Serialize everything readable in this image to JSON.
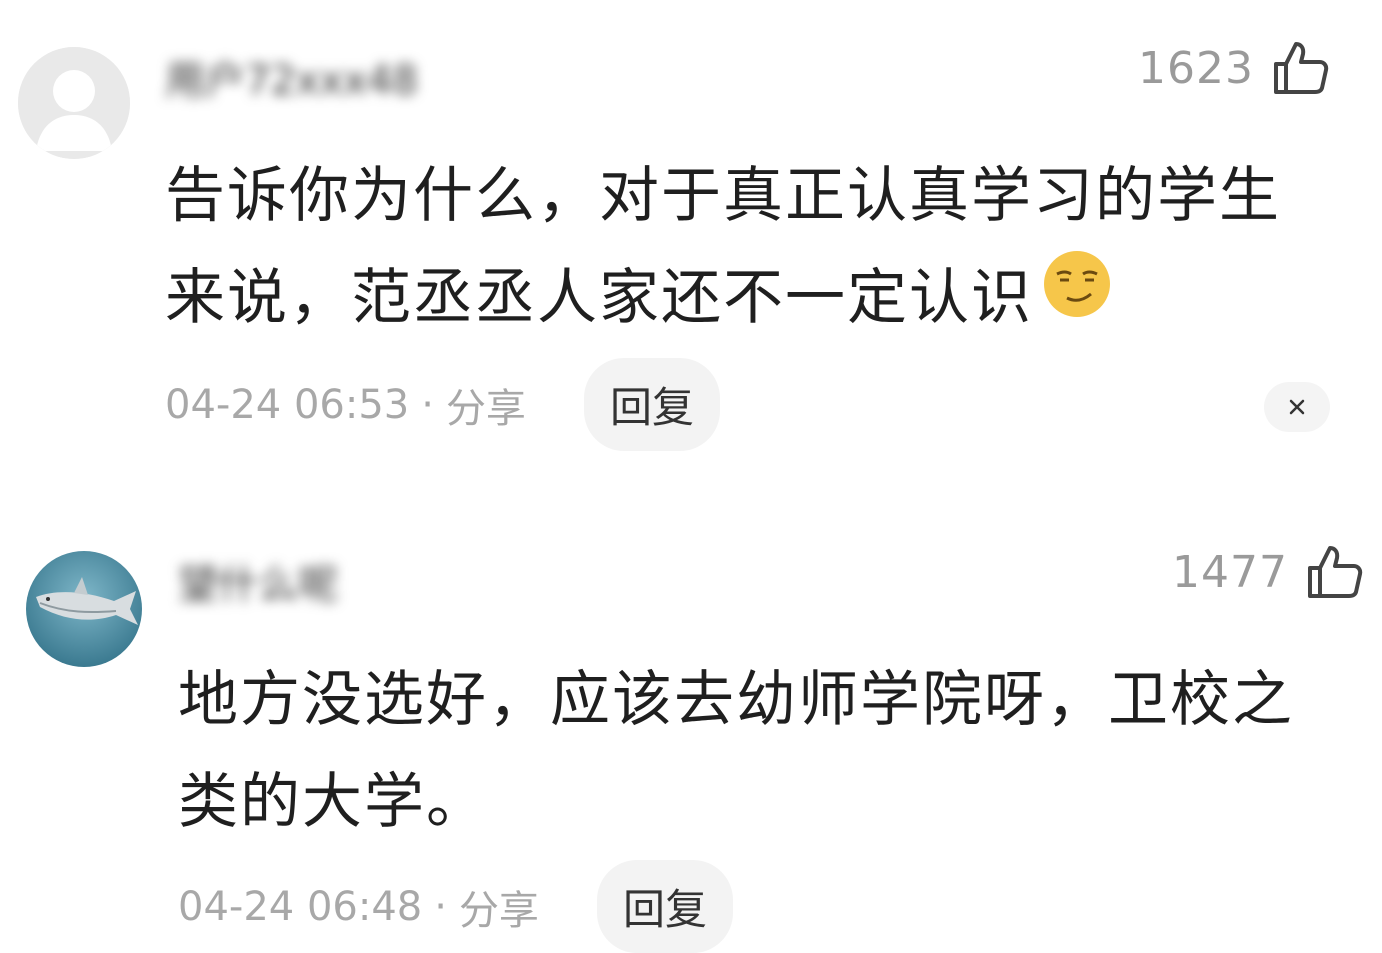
{
  "comments": [
    {
      "username": "用户72xxx48",
      "likes": "1623",
      "lines": [
        "告诉你为什么，对于真正认真学习的学生",
        "来说，范丞丞人家还不一定认识"
      ],
      "emoji": "smirk-emoji",
      "time": "04-24 06:53",
      "separator": "·",
      "share": "分享",
      "reply": "回复",
      "close": "×"
    },
    {
      "username": "望什么呢",
      "likes": "1477",
      "lines": [
        "地方没选好，应该去幼师学院呀，卫校之",
        "类的大学。"
      ],
      "time": "04-24 06:48",
      "separator": "·",
      "share": "分享",
      "reply": "回复"
    }
  ],
  "colors": {
    "text": "#1f1f1f",
    "meta": "#a8a8a8",
    "like": "#9a9a9a",
    "pill_bg": "#f3f3f3"
  }
}
